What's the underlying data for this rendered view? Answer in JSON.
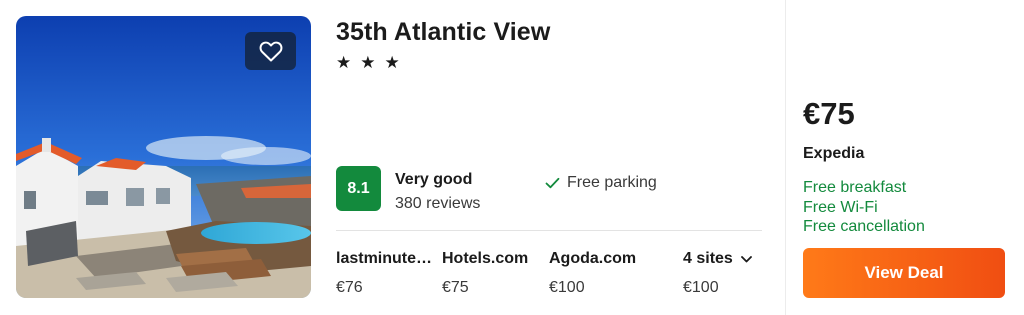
{
  "hotel": {
    "name": "35th Atlantic View",
    "stars": 3,
    "star_glyphs": [
      "★",
      "★",
      "★"
    ]
  },
  "rating": {
    "score": "8.1",
    "label": "Very good",
    "reviews": "380 reviews",
    "color": "#138a3d"
  },
  "amenity": {
    "label": "Free parking",
    "icon": "check-icon"
  },
  "sites": [
    {
      "name": "lastminute…",
      "price": "€76"
    },
    {
      "name": "Hotels.com",
      "price": "€75"
    },
    {
      "name": "Agoda.com",
      "price": "€100"
    }
  ],
  "more_sites": {
    "name": "4 sites",
    "price": "€100",
    "icon": "chevron-down-icon"
  },
  "best_offer": {
    "price": "€75",
    "provider": "Expedia",
    "perks": [
      "Free breakfast",
      "Free Wi-Fi",
      "Free cancellation"
    ],
    "perk_color": "#138a3d",
    "button_label": "View Deal",
    "button_color": "#f5621a"
  },
  "favorite": {
    "icon": "heart-icon"
  }
}
